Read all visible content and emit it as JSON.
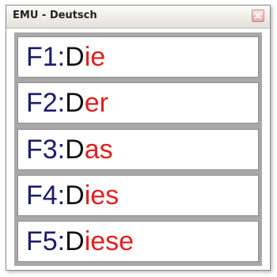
{
  "window": {
    "title": "EMU - Deutsch",
    "close_icon": "close-x-icon"
  },
  "colors": {
    "key": "#1c1c6e",
    "typed": "#111111",
    "completion": "#e02020",
    "list_background": "#a8a8a8"
  },
  "suggestions": [
    {
      "key": "F1: ",
      "typed": "D",
      "completion": "ie"
    },
    {
      "key": "F2: ",
      "typed": "D",
      "completion": "er"
    },
    {
      "key": "F3: ",
      "typed": "D",
      "completion": "as"
    },
    {
      "key": "F4: ",
      "typed": "D",
      "completion": "ies"
    },
    {
      "key": "F5: ",
      "typed": "D",
      "completion": "iese"
    }
  ]
}
